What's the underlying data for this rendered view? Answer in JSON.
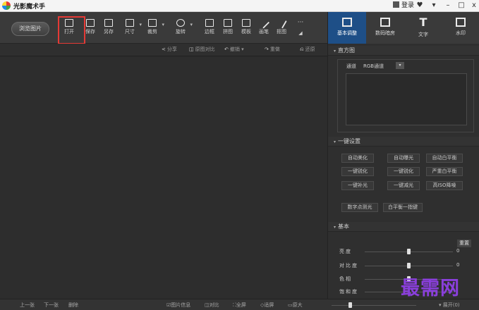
{
  "window": {
    "title": "光影魔术手",
    "login_label": "登录",
    "controls": {
      "settings": "♥",
      "menu": "▾",
      "minimize": "–",
      "maximize": "□",
      "close": "x"
    }
  },
  "toolbar": {
    "browse_label": "浏览图片",
    "tools": [
      {
        "id": "open",
        "label": "打开",
        "icon": "open-image-icon"
      },
      {
        "id": "save",
        "label": "保存",
        "icon": "save-icon"
      },
      {
        "id": "saveas",
        "label": "另存",
        "icon": "save-as-icon"
      },
      {
        "id": "size",
        "label": "尺寸",
        "icon": "resize-icon"
      },
      {
        "id": "crop",
        "label": "裁剪",
        "icon": "crop-icon"
      },
      {
        "id": "rotate",
        "label": "旋转",
        "icon": "rotate-icon"
      },
      {
        "id": "border",
        "label": "边框",
        "icon": "border-icon"
      },
      {
        "id": "collage",
        "label": "拼图",
        "icon": "collage-icon"
      },
      {
        "id": "template",
        "label": "模板",
        "icon": "template-icon"
      },
      {
        "id": "brush",
        "label": "画笔",
        "icon": "brush-icon"
      },
      {
        "id": "matting",
        "label": "抠图",
        "icon": "matting-icon"
      },
      {
        "id": "more",
        "label": "···",
        "icon": "more-icon"
      }
    ]
  },
  "subbar": {
    "share": "分享",
    "compare": "原图对比",
    "undo": "撤销",
    "redo": "重做",
    "restore": "还原"
  },
  "bottombar": {
    "prev": "上一张",
    "next": "下一张",
    "delete": "删除",
    "info": "图片信息",
    "compare": "对比",
    "fullscreen": "全屏",
    "fit": "适屏",
    "original": "原大",
    "expand": "展开(0)"
  },
  "right_tabs": [
    {
      "label": "基本调整",
      "icon": "adjust-icon",
      "active": true
    },
    {
      "label": "数码暗房",
      "icon": "darkroom-icon",
      "active": false
    },
    {
      "label": "文字",
      "icon": "text-icon",
      "active": false
    },
    {
      "label": "水印",
      "icon": "watermark-icon",
      "active": false
    }
  ],
  "histogram": {
    "section_title": "直方图",
    "channel_label": "通道",
    "channel_value": "RGB通道"
  },
  "one_click": {
    "section_title": "一键设置",
    "buttons": [
      [
        "自动美化",
        "自动曝光",
        "自动白平衡"
      ],
      [
        "一键锐化",
        "一键锐化",
        "严重白平衡"
      ],
      [
        "一键补光",
        "一键减光",
        "高ISO降噪"
      ],
      [
        "数字点测光",
        "白平衡一指键"
      ]
    ]
  },
  "basic": {
    "section_title": "基本",
    "reset_label": "重置",
    "sliders": [
      {
        "label": "亮度",
        "value": "0"
      },
      {
        "label": "对比度",
        "value": "0"
      },
      {
        "label": "色相",
        "value": ""
      },
      {
        "label": "饱和度",
        "value": ""
      }
    ]
  },
  "watermark_text": "最需网",
  "colors": {
    "active_tab": "#1e4f87",
    "highlight": "#e53935",
    "watermark": "#8a3fdc"
  }
}
